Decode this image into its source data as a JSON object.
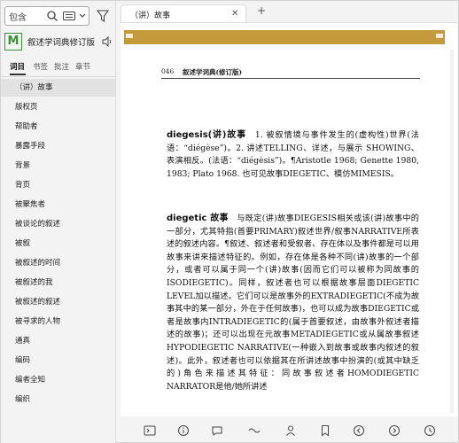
{
  "sidebar": {
    "search": {
      "value": "包含"
    },
    "book": {
      "logo": "M",
      "title": "叙述学词典修订版"
    },
    "tabs": [
      "词目",
      "书签",
      "批注",
      "章节"
    ],
    "items": [
      "（讲）故事",
      "版权页",
      "帮助者",
      "暴露手段",
      "背景",
      "背页",
      "被聚焦者",
      "被谈论的叙述",
      "被叙",
      "被叙述的时间",
      "被叙述的我",
      "被叙述的叙述",
      "被寻求的人物",
      "通真",
      "编码",
      "编者全知",
      "编织"
    ]
  },
  "main": {
    "tab_title": "（讲）故事",
    "page_number": "046",
    "running_head": "叙述学词典(修订版)",
    "paragraph1_term": "diegesis(讲)故事",
    "paragraph1": "　1. 被叙情境与事件发生的(虚构性)世界(法语：“diégèse”)。2. 讲述TELLING、详述，与展示 SHOWING、表演相反。(法语：“diégèsis”)。¶Aristotle 1968; Genette 1980, 1983; Plato 1968. 也可见故事DIEGETIC、模仿MIMESIS。",
    "paragraph2_term": "diegetic 故事",
    "paragraph2": "　与既定(讲)故事DIEGESIS相关或该(讲)故事中的一部分，尤其特指(首要PRIMARY)叙述世界/叙事NARRATIVE所表述的叙述内容。¶叙述、叙述者和受叙者、存在体以及事件都是可以用故事来讲来描述特征的。例如，存在体是各种不同(讲)故事的一个部分，或者可以属于同一个(讲)故事(因而它们可以被称为同故事的 ISODIEGETIC)。同样，叙述者也可以根据故事层面DIEGETIC LEVEL加以描述。它们可以是故事外的EXTRADIEGETIC(不成为故事其中的某一部分，外在于任何故事)，也可以成为故事DIEGETIC或者是故事内INTRADIEGETIC的(属于首要叙述，由故事外叙述者描述的故事)；还可以出现在元故事METADIEGETIC或从属故事叙述HYPODIEGETIC NARRATIVE(一种嵌入到故事或故事内叙述的叙述)。此外，叙述者也可以依据其在所讲述故事中扮演的(或其中缺乏的)角色来描述其特征：同故事叙述者HOMODIEGETIC NARRATOR是他/她所讲述"
  },
  "colors": {
    "band": "#c59a3a",
    "logo": "#3b8d3b"
  }
}
